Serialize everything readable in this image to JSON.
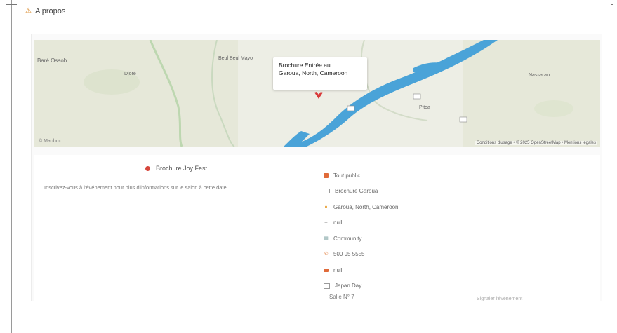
{
  "header": {
    "icon": "warning-icon",
    "label": "A propos"
  },
  "map": {
    "popup_line1": "Brochure Entrée au",
    "popup_line2": "Garoua, North, Cameroon",
    "labels": [
      {
        "text": "Baré Ossob"
      },
      {
        "text": "Djoré"
      },
      {
        "text": "Beul Beul Mayo"
      },
      {
        "text": "Nassarao"
      },
      {
        "text": "Pitoa"
      }
    ],
    "attribution": "Conditions d'usage • © 2025 OpenStreetMap • Mentions légales",
    "logo": "© Mapbox",
    "colors": {
      "land": "#e6e8d9",
      "water": "#4aa3d8",
      "pin": "#d93a3a"
    }
  },
  "event": {
    "name": "Brochure Joy Fest",
    "description": "Inscrivez-vous à l'événement pour plus d'informations sur le salon à cette date..."
  },
  "info": [
    {
      "icon": "square-icon",
      "text": "Tout public"
    },
    {
      "icon": "calendar-icon",
      "text": "Brochure Garoua"
    },
    {
      "icon": "location-pin-icon",
      "text": "Garoua, North, Cameroon"
    },
    {
      "icon": "dash-icon",
      "text": "null"
    },
    {
      "icon": "grid-icon",
      "text": "Community"
    },
    {
      "icon": "phone-icon",
      "text": "500 95 5555"
    },
    {
      "icon": "mail-icon",
      "text": "null"
    },
    {
      "icon": "document-icon",
      "text": "Japan Day"
    }
  ],
  "footer": {
    "left_text": "Salle N° 7",
    "right_text": "Signaler l'événement"
  }
}
